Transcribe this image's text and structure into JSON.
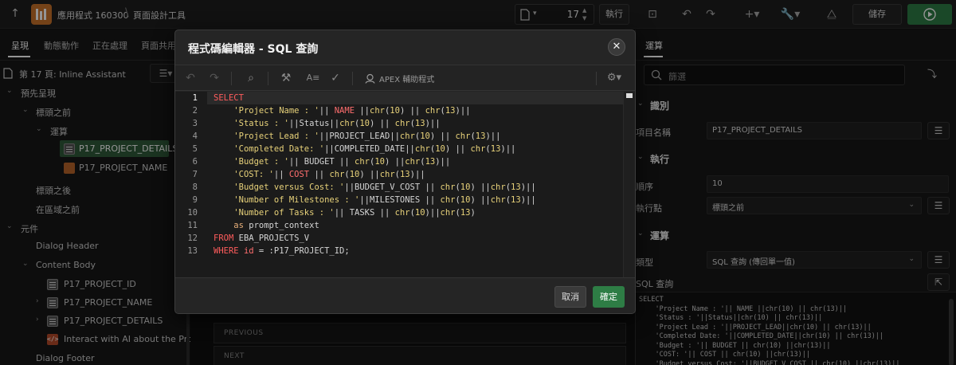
{
  "topbar": {
    "app_label": "應用程式 160300",
    "breadcrumb_tool": "頁面設計工具",
    "page_number": "17",
    "run_label": "執行",
    "save_label": "儲存"
  },
  "left": {
    "tabs": [
      "呈現",
      "動態動作",
      "正在處理",
      "頁面共用"
    ],
    "page_title": "第 17 頁: Inline Assistant",
    "tree": [
      "預先呈現",
      "標頭之前",
      "運算",
      "P17_PROJECT_DETAILS",
      "P17_PROJECT_NAME",
      "標頭之後",
      "在區域之前",
      "元件",
      "Dialog Header",
      "Content Body",
      "P17_PROJECT_ID",
      "P17_PROJECT_NAME",
      "P17_PROJECT_DETAILS",
      "Interact with AI about the Project:",
      "Dialog Footer"
    ]
  },
  "center": {
    "previous_label": "PREVIOUS",
    "next_label": "NEXT"
  },
  "right": {
    "tab": "運算",
    "search_placeholder": "篩選",
    "sections": {
      "identification": "識別",
      "execution": "執行",
      "computation": "運算"
    },
    "labels": {
      "item_name": "項目名稱",
      "sequence": "順序",
      "point": "執行點",
      "type": "類型",
      "sql_query": "SQL 查詢"
    },
    "values": {
      "item_name": "P17_PROJECT_DETAILS",
      "sequence": "10",
      "point": "標頭之前",
      "type": "SQL 查詢 (傳回單一值)"
    },
    "code_preview": "SELECT\n    'Project Name : '|| NAME ||chr(10) || chr(13)||\n    'Status : '||Status||chr(10) || chr(13)||\n    'Project Lead : '||PROJECT_LEAD||chr(10) || chr(13)||\n    'Completed Date: '||COMPLETED_DATE||chr(10) || chr(13)||\n    'Budget : '|| BUDGET || chr(10) ||chr(13)||\n    'COST: '|| COST || chr(10) ||chr(13)||\n    'Budget versus Cost: '||BUDGET_V_COST || chr(10) ||chr(13)||"
  },
  "modal": {
    "title": "程式碼編輯器 - SQL 查詢",
    "apex_assistant": "APEX 輔助程式",
    "cancel": "取消",
    "ok": "確定",
    "line_numbers": [
      "1",
      "2",
      "3",
      "4",
      "5",
      "6",
      "7",
      "8",
      "9",
      "10",
      "11",
      "12",
      "13"
    ]
  },
  "colors": {
    "accent_green": "#2e7d45",
    "app_orange": "#c9732a",
    "keyword_red": "#ff5c5c",
    "string_yellow": "#e8d27a"
  }
}
